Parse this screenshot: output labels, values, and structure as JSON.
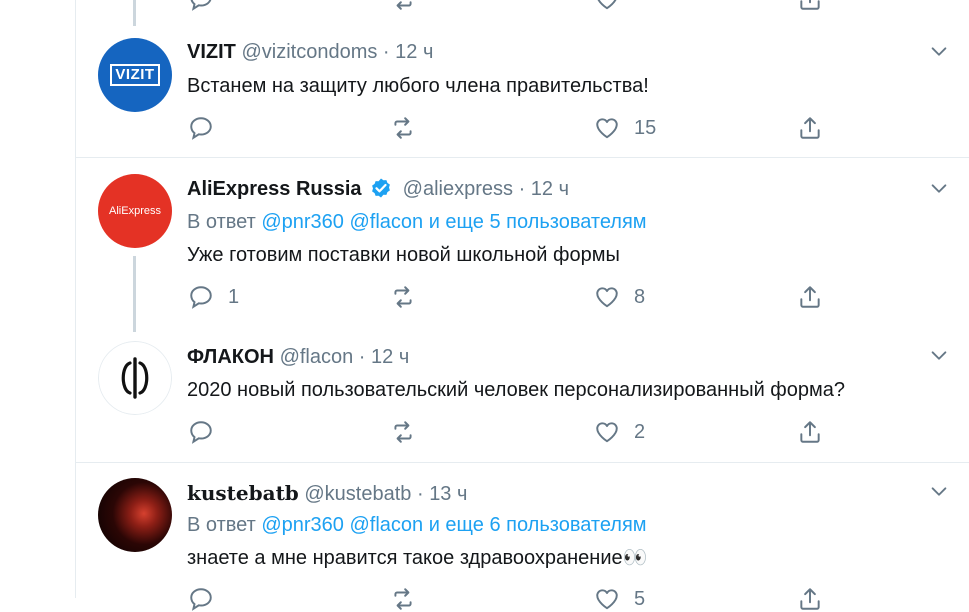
{
  "colors": {
    "accent": "#1da1f2",
    "muted": "#657786",
    "text": "#14171a",
    "divider": "#e6ecf0"
  },
  "top_partial": {
    "icons": [
      "reply-icon",
      "retweet-icon",
      "like-icon",
      "share-icon"
    ]
  },
  "tweets": [
    {
      "avatar_icon": "vizit-logo",
      "avatar_text": "VIZIT",
      "name": "VIZIT",
      "handle": "@vizitcondoms",
      "dot": "·",
      "time": "12 ч",
      "text": "Встанем на защиту любого члена правительства!",
      "actions": {
        "reply_count": "",
        "retweet_count": "",
        "like_count": "15"
      }
    },
    {
      "avatar_icon": "aliexpress-logo",
      "avatar_text": "AliExpress",
      "name": "AliExpress Russia",
      "verified_icon": "verified-badge-icon",
      "handle": "@aliexpress",
      "dot": "·",
      "time": "12 ч",
      "reply_prefix": "В ответ",
      "reply_mention_1": "@pnr360",
      "reply_mention_2": "@flacon",
      "reply_rest": "и еще 5 пользователям",
      "text": "Уже готовим поставки новой школьной формы",
      "actions": {
        "reply_count": "1",
        "retweet_count": "",
        "like_count": "8"
      }
    },
    {
      "avatar_icon": "flacon-logo",
      "name": "ФЛАКОН",
      "handle": "@flacon",
      "dot": "·",
      "time": "12 ч",
      "text": "2020 новый пользовательский человек персонализированный форма?",
      "actions": {
        "reply_count": "",
        "retweet_count": "",
        "like_count": "2"
      }
    },
    {
      "avatar_icon": "profile-photo",
      "name": "𝐤𝐮𝐬𝐭𝐞𝐛𝐚𝐭𝐛",
      "handle": "@kustebatb",
      "dot": "·",
      "time": "13 ч",
      "reply_prefix": "В ответ",
      "reply_mention_1": "@pnr360",
      "reply_mention_2": "@flacon",
      "reply_rest": "и еще 6 пользователям",
      "text": "знаете а мне нравится такое здравоохранение👀",
      "actions": {
        "reply_count": "",
        "retweet_count": "",
        "like_count": "5"
      }
    }
  ]
}
